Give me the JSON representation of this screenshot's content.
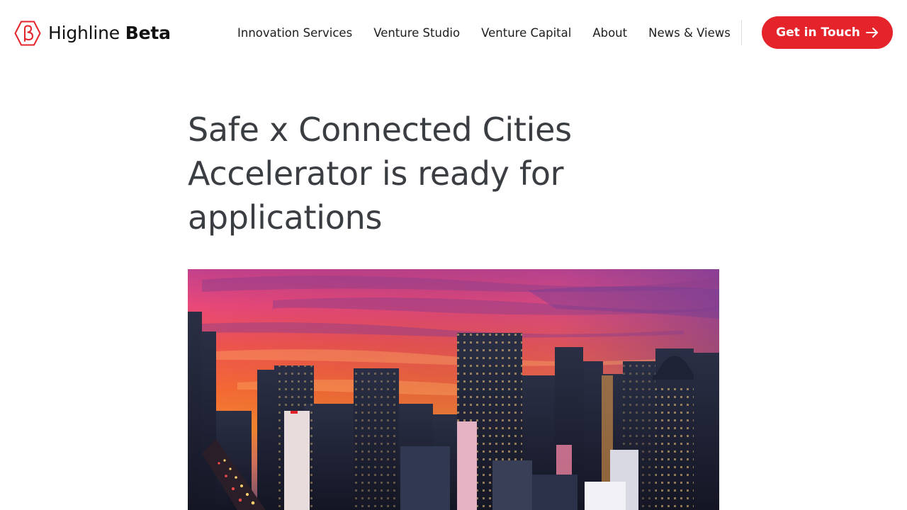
{
  "brand": {
    "name_light": "Highline",
    "name_bold": "Beta",
    "logo_icon": "beta-hexagon-icon",
    "accent_color": "#e5232a"
  },
  "nav": {
    "items": [
      {
        "label": "Innovation Services"
      },
      {
        "label": "Venture Studio"
      },
      {
        "label": "Venture Capital"
      },
      {
        "label": "About"
      },
      {
        "label": "News & Views"
      }
    ]
  },
  "cta": {
    "label": "Get in Touch",
    "icon": "arrow-right-icon"
  },
  "article": {
    "title": "Safe x Connected Cities Accelerator is ready for applications",
    "hero_image": "city-skyline-sunset-photo"
  }
}
